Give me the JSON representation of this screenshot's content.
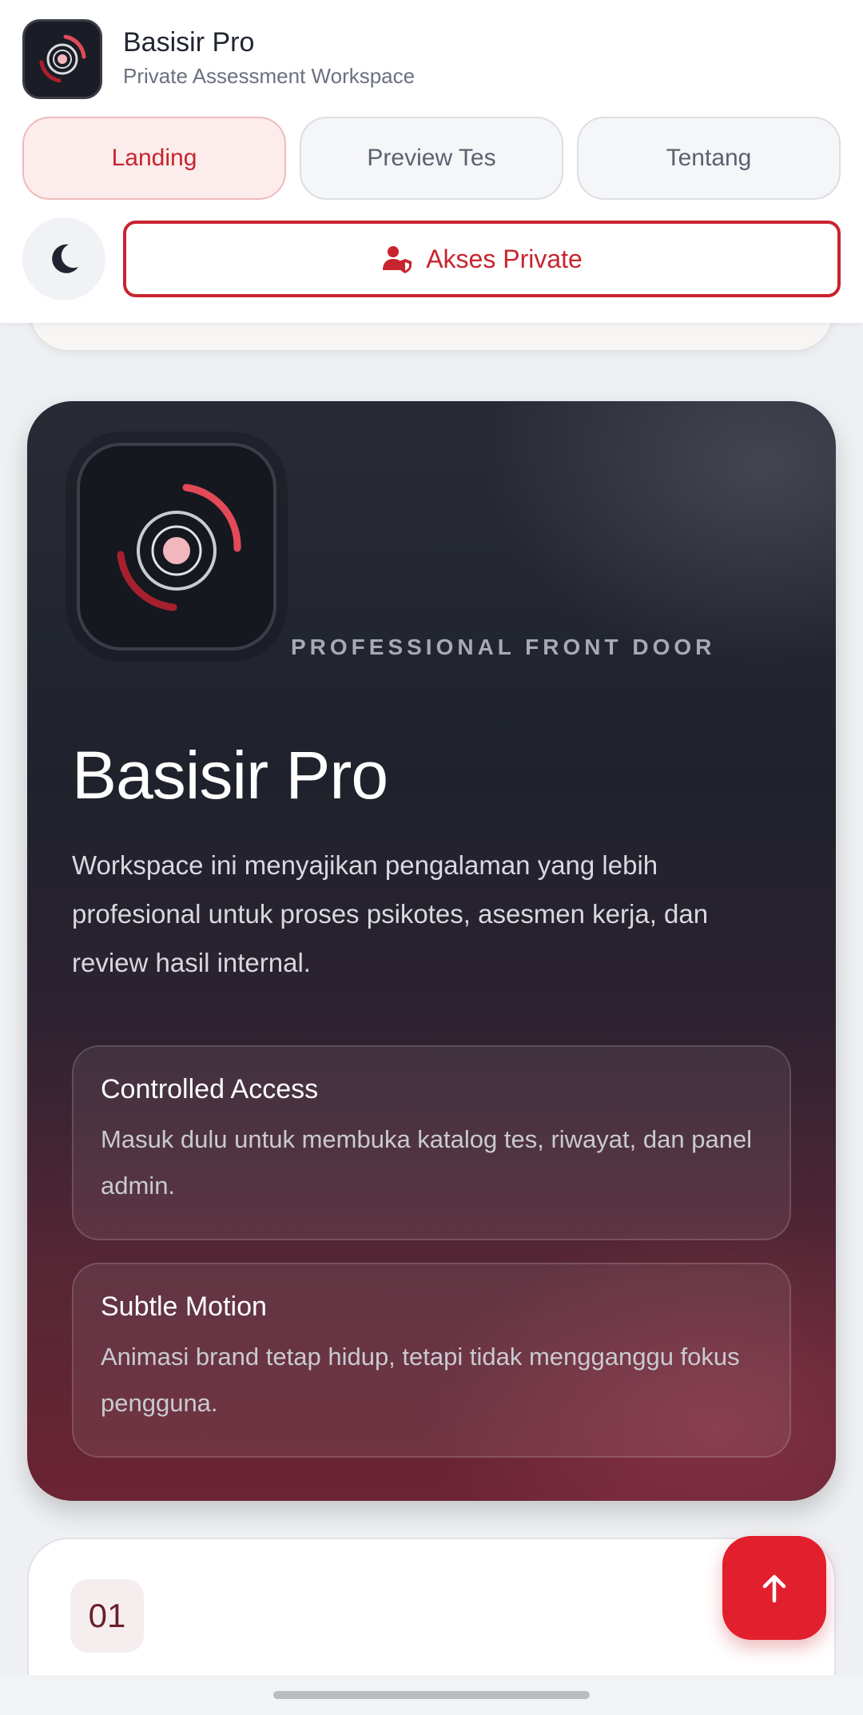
{
  "header": {
    "brand_title": "Basisir Pro",
    "brand_subtitle": "Private Assessment Workspace",
    "tabs": [
      {
        "label": "Landing",
        "active": true
      },
      {
        "label": "Preview Tes",
        "active": false
      },
      {
        "label": "Tentang",
        "active": false
      }
    ],
    "theme_icon": "moon-icon",
    "private_button": {
      "label": "Akses Private",
      "icon": "user-shield-icon"
    }
  },
  "hero": {
    "eyebrow": "PROFESSIONAL FRONT DOOR",
    "title": "Basisir Pro",
    "description": "Workspace ini menyajikan pengalaman yang lebih profesional untuk proses psikotes, asesmen kerja, dan review hasil internal.",
    "features": [
      {
        "title": "Controlled Access",
        "description": "Masuk dulu untuk membuka katalog tes, riwayat, dan panel admin."
      },
      {
        "title": "Subtle Motion",
        "description": "Animasi brand tetap hidup, tetapi tidak mengganggu fokus pengguna."
      }
    ]
  },
  "next_section": {
    "number": "01"
  },
  "fab": {
    "icon": "arrow-up-icon"
  },
  "colors": {
    "accent": "#c8242f",
    "fab": "#e21f2c",
    "hero_dark": "#1f222c",
    "hero_wine": "#6b2434"
  }
}
